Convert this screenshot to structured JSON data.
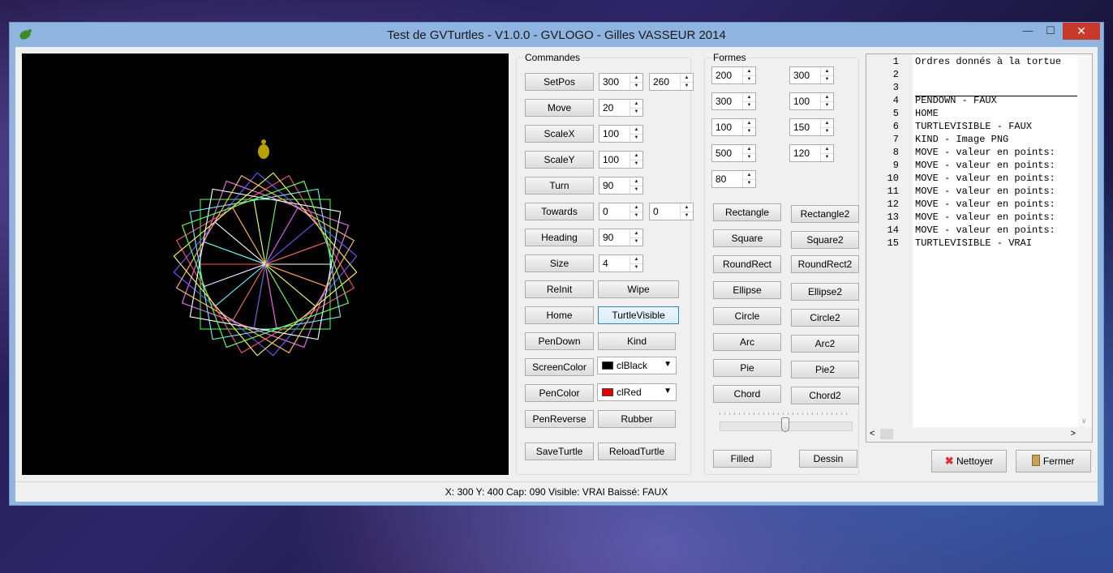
{
  "window": {
    "title": "Test de GVTurtles - V1.0.0 - GVLOGO - Gilles VASSEUR 2014",
    "minimize": "—",
    "maximize": "☐",
    "close": "✕"
  },
  "commandes": {
    "title": "Commandes",
    "setpos": {
      "label": "SetPos",
      "x": "300",
      "y": "260"
    },
    "move": {
      "label": "Move",
      "value": "20"
    },
    "scalex": {
      "label": "ScaleX",
      "value": "100"
    },
    "scaley": {
      "label": "ScaleY",
      "value": "100"
    },
    "turn": {
      "label": "Turn",
      "value": "90"
    },
    "towards": {
      "label": "Towards",
      "x": "0",
      "y": "0"
    },
    "heading": {
      "label": "Heading",
      "value": "90"
    },
    "size": {
      "label": "Size",
      "value": "4"
    },
    "reinit": "ReInit",
    "wipe": "Wipe",
    "home": "Home",
    "turtlevisible": "TurtleVisible",
    "pendown": "PenDown",
    "kind": "Kind",
    "screencolor": {
      "label": "ScreenColor",
      "value": "clBlack",
      "swatch": "#000000"
    },
    "pencolor": {
      "label": "PenColor",
      "value": "clRed",
      "swatch": "#e00000"
    },
    "penreverse": "PenReverse",
    "rubber": "Rubber",
    "saveturtle": "SaveTurtle",
    "reloadturtle": "ReloadTurtle"
  },
  "formes": {
    "title": "Formes",
    "inputs": [
      "200",
      "300",
      "300",
      "100",
      "100",
      "150",
      "500",
      "120",
      "80"
    ],
    "buttons": [
      "Rectangle",
      "Rectangle2",
      "Square",
      "Square2",
      "RoundRect",
      "RoundRect2",
      "Ellipse",
      "Ellipse2",
      "Circle",
      "Circle2",
      "Arc",
      "Arc2",
      "Pie",
      "Pie2",
      "Chord",
      "Chord2"
    ],
    "filled": "Filled",
    "dessin": "Dessin"
  },
  "memo": {
    "lines": [
      {
        "n": "1",
        "t": "Ordres donnés à la tortue"
      },
      {
        "n": "2",
        "t": ""
      },
      {
        "n": "3",
        "t": ""
      },
      {
        "n": "4",
        "t": "PENDOWN - FAUX"
      },
      {
        "n": "5",
        "t": "HOME"
      },
      {
        "n": "6",
        "t": "TURTLEVISIBLE - FAUX"
      },
      {
        "n": "7",
        "t": "KIND - Image PNG"
      },
      {
        "n": "8",
        "t": "MOVE - valeur en points:"
      },
      {
        "n": "9",
        "t": "MOVE - valeur en points:"
      },
      {
        "n": "10",
        "t": "MOVE - valeur en points:"
      },
      {
        "n": "11",
        "t": "MOVE - valeur en points:"
      },
      {
        "n": "12",
        "t": "MOVE - valeur en points:"
      },
      {
        "n": "13",
        "t": "MOVE - valeur en points:"
      },
      {
        "n": "14",
        "t": "MOVE - valeur en points:"
      },
      {
        "n": "15",
        "t": "TURTLEVISIBLE - VRAI"
      }
    ]
  },
  "actions": {
    "nettoyer": "Nettoyer",
    "fermer": "Fermer"
  },
  "status": "X: 300 Y: 400 Cap: 090 Visible: VRAI Baissé: FAUX",
  "colors": {
    "canvas": "#000000",
    "titlebar": "#8fb4e0",
    "close": "#c7392b",
    "turtle": "#b8a000"
  },
  "icons": [
    "app-turtle-icon",
    "minimize-icon",
    "maximize-icon",
    "close-icon",
    "spin-up-icon",
    "spin-down-icon",
    "dropdown-icon",
    "delete-x-icon",
    "door-icon",
    "scroll-left-icon",
    "scroll-right-icon",
    "scroll-down-icon"
  ]
}
